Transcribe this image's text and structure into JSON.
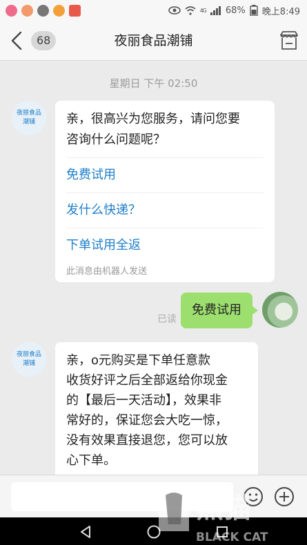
{
  "status_bar": {
    "signal_label": "4G",
    "battery": "68%",
    "time": "晚上8:49"
  },
  "header": {
    "unread_count": "68",
    "title": "夜丽食品潮铺"
  },
  "chat": {
    "timestamp": "星期日 下午 02:50",
    "shop_avatar_text_line1": "夜丽食品",
    "shop_avatar_text_line2": "潮铺",
    "messages": [
      {
        "text_line1": "亲，很高兴为您服务，请问您要",
        "text_line2": "咨询什么问题呢？",
        "quick_replies": [
          "免费试用",
          "发什么快递？",
          "下单试用全返"
        ],
        "bot_note": "此消息由机器人发送"
      },
      {
        "read_status": "已读",
        "text": "免费试用"
      },
      {
        "lines": [
          "亲，o元购买是下单任意款",
          "收货好评之后全部返给你现金",
          "的【最后一天活动】，效果非",
          "常好的，保证您会大吃一惊，",
          "没有效果直接退您，您可以放",
          "心下单。"
        ]
      }
    ]
  },
  "input": {
    "value": "",
    "emoji_icon": "emoji-icon",
    "plus_icon": "plus-icon"
  },
  "watermark": {
    "text": "黑猫",
    "subtext": "BLACK CAT"
  },
  "colors": {
    "link": "#1e7fc9",
    "user_bubble": "#9ddf6f",
    "background": "#ebebeb"
  }
}
